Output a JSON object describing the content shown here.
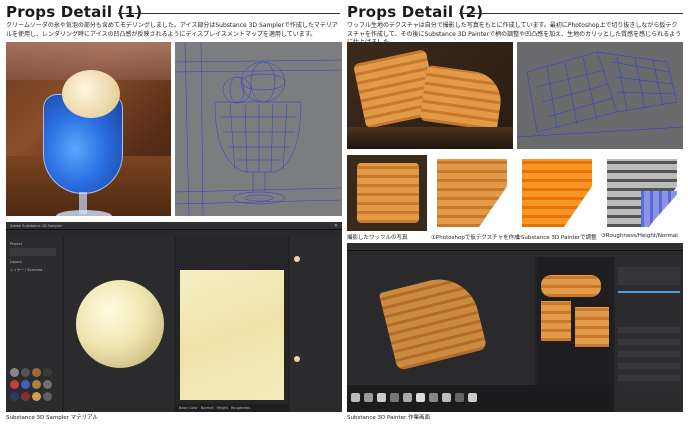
{
  "left": {
    "title": "Props Detail (1)",
    "description": "クリームソーダの氷や気泡の部分も含めてモデリングしました。アイス部分はSubstance 3D Samplerで作成したマテリアルを使用し、レンダリング時にアイスの凹凸感が反映されるようにディスプレイスメントマップを適用しています。",
    "caption": "Substance 3D Sampler マテリアル",
    "app": {
      "window_title": "Adobe Substance 3D Sampler",
      "panel_items": [
        "Project",
        "Layers",
        "レイヤー / Scanned"
      ],
      "tabs": [
        "Sampler"
      ],
      "bottom_tabs": [
        "Base Color",
        "Normal",
        "Height",
        "Roughness",
        "Metallic"
      ]
    }
  },
  "right": {
    "title": "Props Detail (2)",
    "description": "ワッフル生地のテクスチャは自分で撮影した写真をもとに作成しています。最初にPhotoshop上で切り抜きしながら仮テクスチャを作成して、その後にSubstance 3D Painterで柄の調整や凹凸感を加え、生地のカリッとした質感を感じられるように仕上げました。",
    "steps": [
      {
        "label": "撮影したワッフルの写真"
      },
      {
        "label": "①Photoshopで仮テクスチャを作成"
      },
      {
        "label": "②Substance 3D Painterで調整"
      },
      {
        "label": "③Roughness/Height/Normal"
      }
    ],
    "caption": "Substance 3D Painter 作業画面"
  },
  "colors": {
    "accent_blue": "#2b6fe0",
    "ui_dark": "#232325",
    "waffle": "#d58a3b"
  }
}
